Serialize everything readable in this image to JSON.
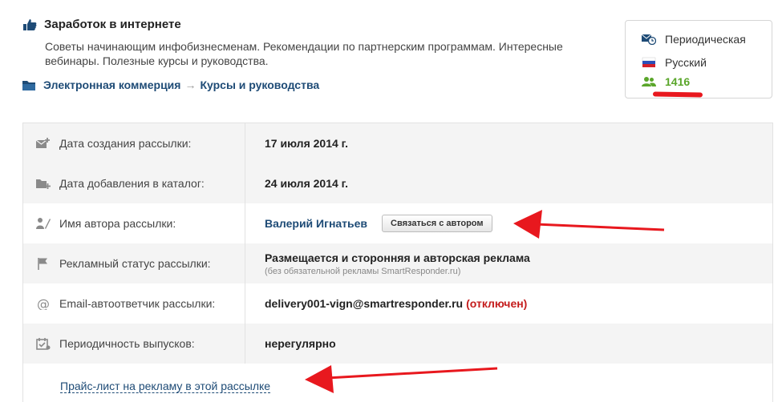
{
  "header": {
    "title": "Заработок в интернете",
    "description": "Советы начинающим инфобизнесменам. Рекомендации по партнерским программам. Интересные вебинары. Полезные курсы и руководства.",
    "breadcrumb": {
      "category": "Электронная коммерция",
      "separator": "→",
      "subcategory": "Курсы и руководства"
    }
  },
  "info": {
    "frequency": "Периодическая",
    "language": "Русский",
    "subscribers": "1416"
  },
  "rows": [
    {
      "label": "Дата создания рассылки:",
      "value": "17 июля 2014 г.",
      "icon": "mail-add-icon"
    },
    {
      "label": "Дата добавления в каталог:",
      "value": "24 июля 2014 г.",
      "icon": "folder-add-icon"
    },
    {
      "label": "Имя автора рассылки:",
      "value": "Валерий Игнатьев",
      "button": "Связаться с автором",
      "icon": "author-icon"
    },
    {
      "label": "Рекламный статус рассылки:",
      "value": "Размещается и сторонняя и авторская реклама",
      "note": "(без обязательной рекламы SmartResponder.ru)",
      "icon": "flag-icon"
    },
    {
      "label": "Email-автоответчик рассылки:",
      "value": "delivery001-vign@smartresponder.ru",
      "status": "(отключен)",
      "icon": "at-icon"
    },
    {
      "label": "Периодичность выпусков:",
      "value": "нерегулярно",
      "icon": "calendar-icon"
    }
  ],
  "price_link": "Прайс-лист на рекламу в этой рассылке",
  "colors": {
    "link": "#1e4b76",
    "accent_red": "#e8181e",
    "subscribers_green": "#5aa62a"
  }
}
